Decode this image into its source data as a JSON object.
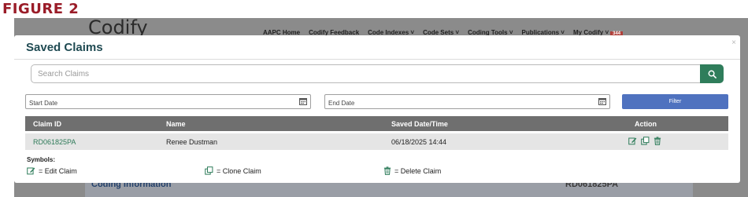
{
  "figure_label": "FIGURE 2",
  "background": {
    "logo": "Codify",
    "nav": [
      "AAPC Home",
      "Codify Feedback",
      "Code Indexes",
      "Code Sets",
      "Coding Tools",
      "Publications",
      "My Codify"
    ],
    "badge": "344",
    "section_title": "Coding Information",
    "claim_id": "RD061825PA"
  },
  "modal": {
    "title": "Saved Claims",
    "close": "×",
    "search_placeholder": "Search Claims",
    "start_date_placeholder": "Start Date",
    "end_date_placeholder": "End Date",
    "filter_label": "Filter",
    "columns": [
      "Claim ID",
      "Name",
      "Saved Date/Time",
      "Action"
    ],
    "rows": [
      {
        "claim_id": "RD061825PA",
        "name": "Renee Dustman",
        "saved": "06/18/2025 14:44"
      }
    ],
    "symbols_title": "Symbols:",
    "legend": {
      "edit": "= Edit Claim",
      "clone": "= Clone Claim",
      "delete": "= Delete Claim"
    }
  },
  "colors": {
    "accent_green": "#2f7d5b",
    "filter_blue": "#4f72bf",
    "header_gray": "#6f6f6f",
    "title_teal": "#1f4a52",
    "figure_red": "#9a1c28"
  },
  "icons": [
    "search-icon",
    "calendar-icon",
    "edit-icon",
    "clone-icon",
    "trash-icon",
    "close-icon"
  ]
}
